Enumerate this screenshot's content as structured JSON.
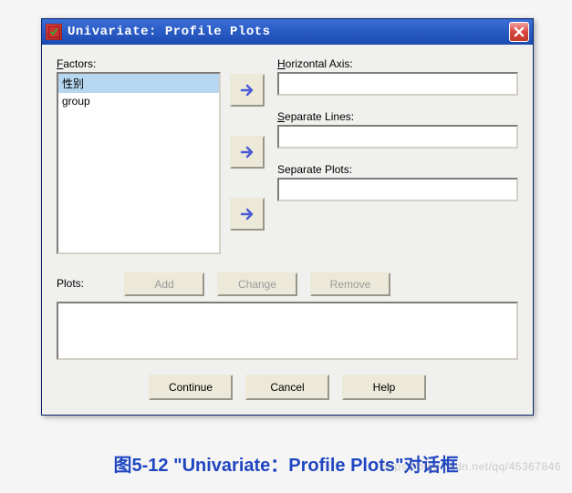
{
  "window": {
    "title": "Univariate: Profile Plots"
  },
  "labels": {
    "factors": "Factors:",
    "horizontal_axis": "Horizontal Axis:",
    "separate_lines": "Separate Lines:",
    "separate_plots": "Separate Plots:",
    "plots": "Plots:"
  },
  "factors": {
    "items": [
      "性别",
      "group"
    ],
    "selected_index": 0
  },
  "fields": {
    "horizontal_axis": "",
    "separate_lines": "",
    "separate_plots": ""
  },
  "buttons": {
    "add": "Add",
    "change": "Change",
    "remove": "Remove",
    "continue": "Continue",
    "cancel": "Cancel",
    "help": "Help"
  },
  "buttons_enabled": {
    "add": false,
    "change": false,
    "remove": false
  },
  "caption": "图5-12 \"Univariate：Profile Plots\"对话框",
  "watermark": "https://blog.csdn.net/qq/45367846"
}
